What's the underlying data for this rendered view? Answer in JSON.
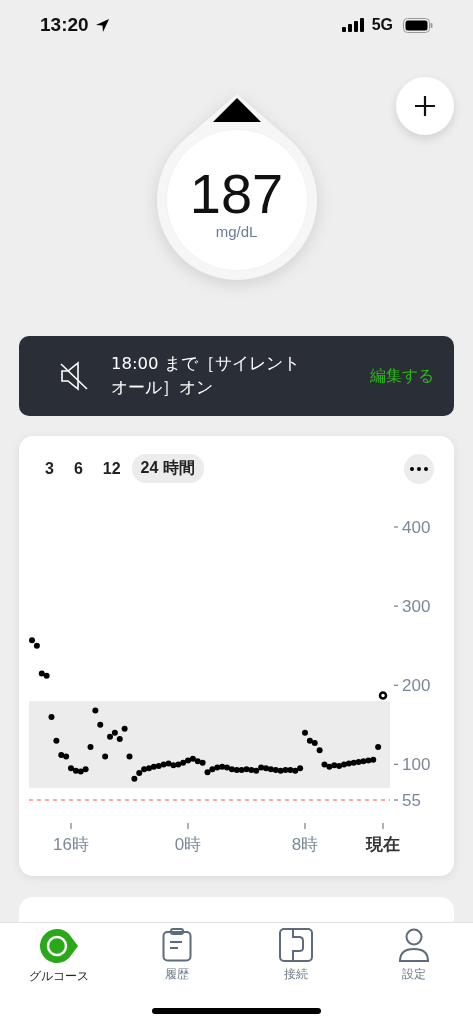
{
  "status_bar": {
    "time": "13:20",
    "network": "5G"
  },
  "reading": {
    "value": "187",
    "unit": "mg/dL"
  },
  "alert_banner": {
    "message": "18:00 まで［サイレントオール］オン",
    "action": "編集する"
  },
  "chart_card": {
    "ranges": [
      {
        "label": "3",
        "selected": false
      },
      {
        "label": "6",
        "selected": false
      },
      {
        "label": "12",
        "selected": false
      },
      {
        "label": "24 時間",
        "selected": true
      }
    ],
    "chart_data": {
      "type": "scatter",
      "categories": [
        null,
        null,
        null,
        null,
        null,
        null,
        null,
        null,
        "16時",
        null,
        null,
        null,
        null,
        null,
        null,
        null,
        null,
        null,
        null,
        null,
        null,
        null,
        null,
        null,
        null,
        null,
        null,
        null,
        null,
        null,
        null,
        null,
        "0時",
        null,
        null,
        null,
        null,
        null,
        null,
        null,
        null,
        null,
        null,
        null,
        null,
        null,
        null,
        null,
        null,
        null,
        null,
        null,
        null,
        null,
        null,
        null,
        "8時",
        null,
        null,
        null,
        null,
        null,
        null,
        null,
        null,
        null,
        null,
        null,
        null,
        null,
        null,
        null,
        "現在"
      ],
      "series": [
        {
          "color": "#000000",
          "values": [
            257,
            250,
            215,
            212,
            160,
            130,
            112,
            110,
            95,
            92,
            91,
            94,
            122,
            168,
            150,
            110,
            135,
            140,
            132,
            145,
            110,
            82,
            89,
            94,
            95,
            97,
            98,
            100,
            101,
            99,
            100,
            102,
            105,
            107,
            104,
            102,
            90,
            94,
            96,
            97,
            96,
            94,
            93,
            93,
            94,
            93,
            92,
            96,
            95,
            94,
            93,
            92,
            93,
            93,
            92,
            95,
            140,
            130,
            127,
            118,
            100,
            97,
            99,
            98,
            100,
            101,
            102,
            103,
            104,
            105,
            106,
            122,
            187
          ]
        }
      ],
      "ylim": [
        55,
        400
      ],
      "yticks": [
        {
          "value": 55,
          "label": "55"
        },
        {
          "value": 100,
          "label": "100"
        },
        {
          "value": 200,
          "label": "200"
        },
        {
          "value": 300,
          "label": "300"
        },
        {
          "value": 400,
          "label": "400"
        }
      ],
      "bands": [
        {
          "axis": "y",
          "from": 70,
          "to": 180
        }
      ],
      "ref_lines": [
        {
          "axis": "y",
          "value": 55,
          "color": "#ff8a8a"
        }
      ]
    }
  },
  "tab_bar": [
    {
      "label": "グルコース",
      "kind": "glucose",
      "selected": true
    },
    {
      "label": "履歴",
      "kind": "history",
      "selected": false
    },
    {
      "label": "接続",
      "kind": "connect",
      "selected": false
    },
    {
      "label": "設定",
      "kind": "settings",
      "selected": false
    }
  ]
}
